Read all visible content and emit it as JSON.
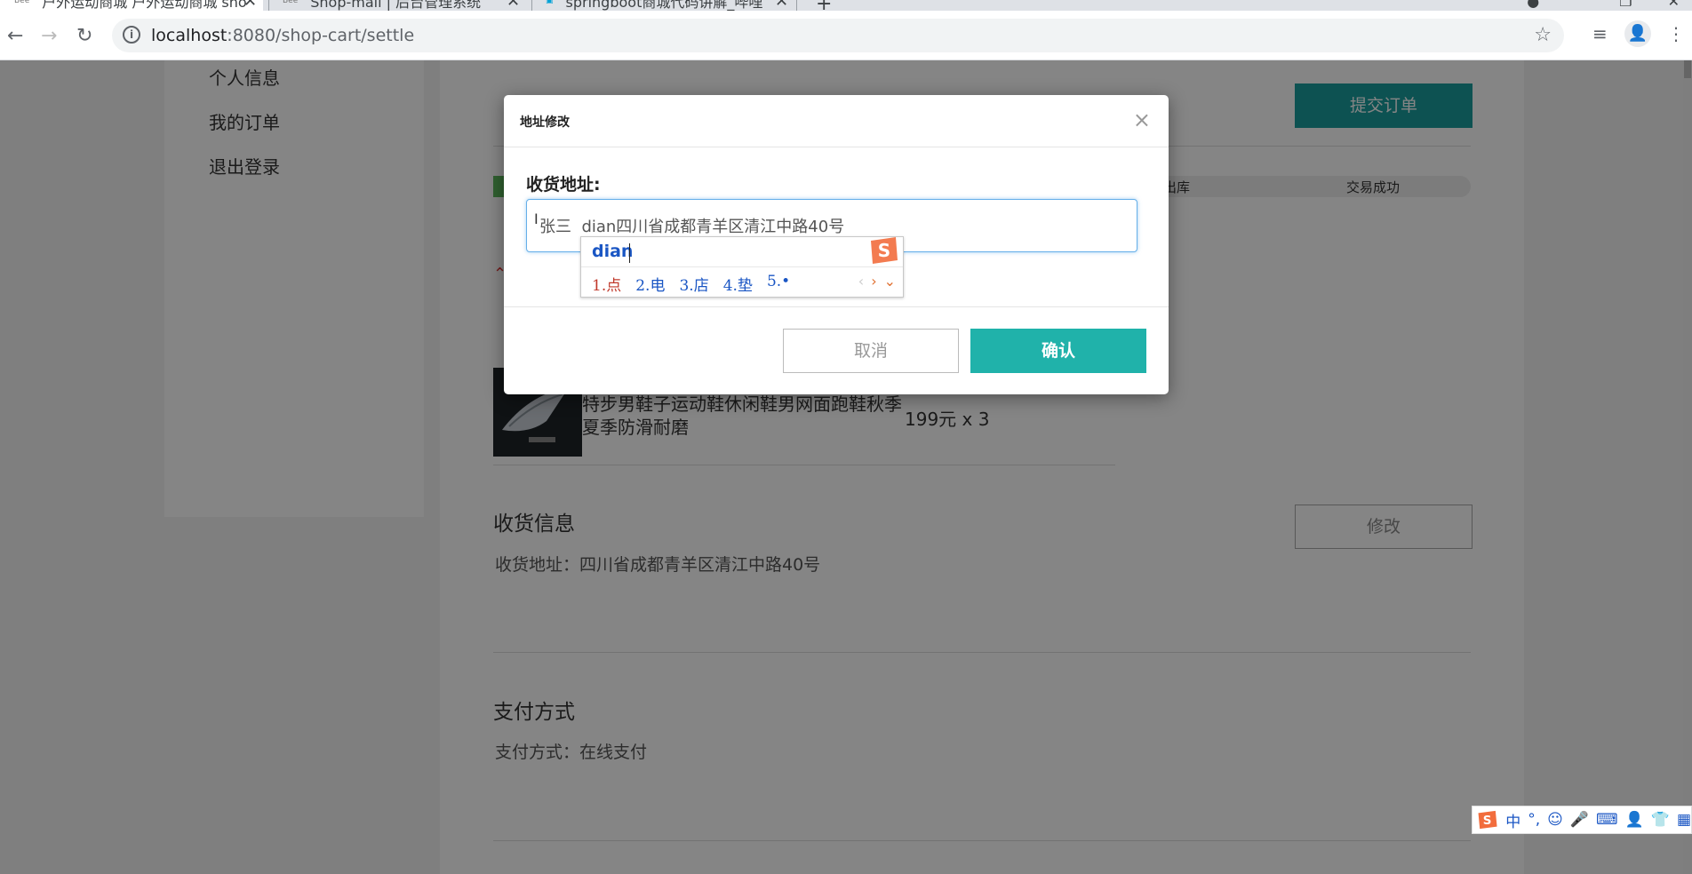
{
  "browser": {
    "tabs": [
      {
        "favicon": "Bee",
        "title": "户外运动商城 户外运动商城 sho",
        "active": true
      },
      {
        "favicon": "Bee",
        "title": "Shop-mall | 后台管理系统",
        "active": false
      },
      {
        "favicon": "bilibili-icon",
        "title": "springboot商城代码讲解_哔哩",
        "active": false
      }
    ],
    "url_host": "localhost",
    "url_path": ":8080/shop-cart/settle"
  },
  "sidebar": {
    "items": [
      "个人信息",
      "我的订单",
      "退出登录"
    ]
  },
  "page": {
    "submit_order": "提交订单",
    "steps": [
      "出库",
      "交易成功"
    ],
    "product": {
      "name": "特步男鞋子运动鞋休闲鞋男网面跑鞋秋季夏季防滑耐磨",
      "price": "199元 x 3"
    },
    "receive": {
      "title": "收货信息",
      "text": "收货地址：四川省成都青羊区清江中路40号",
      "modify": "修改"
    },
    "payment": {
      "title": "支付方式",
      "text": "支付方式：在线支付"
    }
  },
  "modal": {
    "title": "地址修改",
    "close": "×",
    "address_label": "收货地址:",
    "address_value": "张三  dian四川省成都青羊区清江中路40号",
    "cancel": "取消",
    "confirm": "确认"
  },
  "ime": {
    "composition": "dian",
    "candidates": [
      "1.点",
      "2.电",
      "3.店",
      "4.垫",
      "5.•"
    ],
    "bar_items": [
      "中",
      "°,"
    ]
  }
}
